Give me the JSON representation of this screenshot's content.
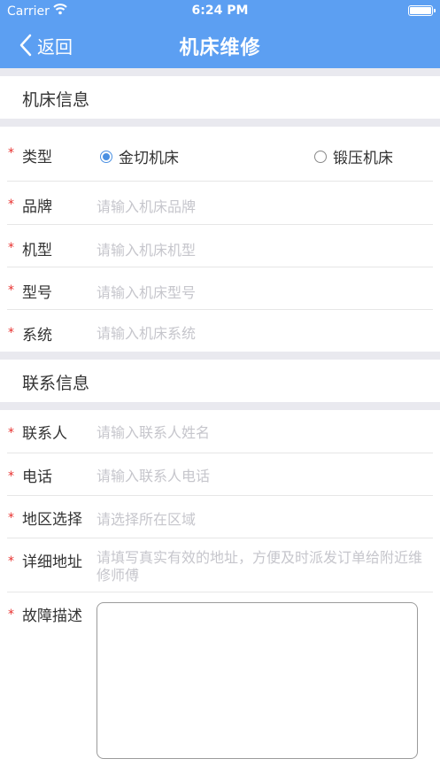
{
  "status_bar": {
    "carrier": "Carrier",
    "time": "6:24 PM"
  },
  "nav": {
    "back_label": "返回",
    "title": "机床维修"
  },
  "machine_section": {
    "title": "机床信息",
    "type": {
      "label": "类型",
      "options": [
        "金切机床",
        "锻压机床"
      ],
      "selected": "金切机床"
    },
    "brand": {
      "label": "品牌",
      "placeholder": "请输入机床品牌"
    },
    "model": {
      "label": "机型",
      "placeholder": "请输入机床机型"
    },
    "type_no": {
      "label": "型号",
      "placeholder": "请输入机床型号"
    },
    "system": {
      "label": "系统",
      "placeholder": "请输入机床系统"
    }
  },
  "contact_section": {
    "title": "联系信息",
    "contact": {
      "label": "联系人",
      "placeholder": "请输入联系人姓名"
    },
    "phone": {
      "label": "电话",
      "placeholder": "请输入联系人电话"
    },
    "region": {
      "label": "地区选择",
      "placeholder": "请选择所在区域"
    },
    "address": {
      "label": "详细地址",
      "placeholder": "请填写真实有效的地址，方便及时派发订单给附近维修师傅"
    },
    "fault": {
      "label": "故障描述"
    }
  },
  "required_mark": "*",
  "colors": {
    "header": "#5c9ff2",
    "required": "#e8302e",
    "radio_selected": "#4a90e2",
    "section_gap": "#e9e9ef"
  }
}
